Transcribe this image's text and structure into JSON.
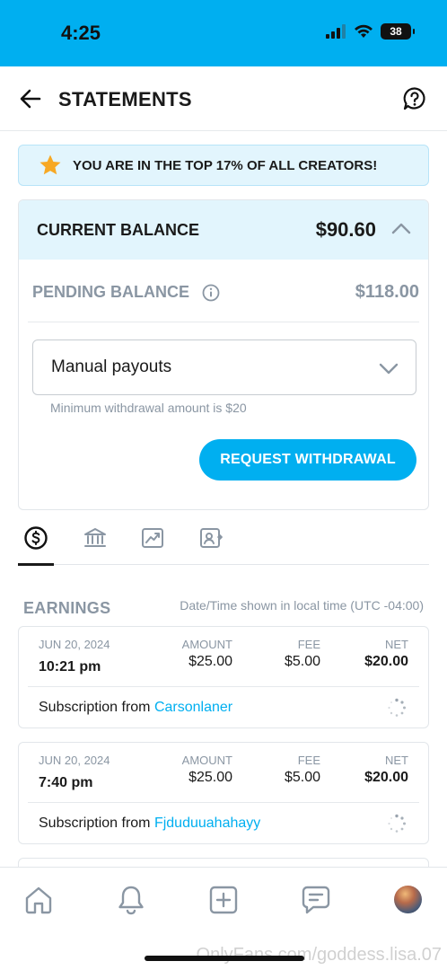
{
  "status_bar": {
    "time": "4:25",
    "battery": "38"
  },
  "header": {
    "title": "STATEMENTS"
  },
  "banner": {
    "text": "YOU ARE IN THE TOP 17% OF ALL CREATORS!"
  },
  "balance": {
    "current_label": "CURRENT BALANCE",
    "current_amount": "$90.60",
    "pending_label": "PENDING BALANCE",
    "pending_amount": "$118.00",
    "payout_mode": "Manual payouts",
    "min_note": "Minimum withdrawal amount is $20",
    "withdraw_label": "REQUEST WITHDRAWAL"
  },
  "tabs": [
    {
      "icon": "dollar-circle-icon"
    },
    {
      "icon": "bank-icon"
    },
    {
      "icon": "chart-icon"
    },
    {
      "icon": "id-card-icon"
    }
  ],
  "earnings": {
    "title": "EARNINGS",
    "note": "Date/Time shown in local time (UTC -04:00)",
    "col_amount": "AMOUNT",
    "col_fee": "FEE",
    "col_net": "NET",
    "rows": [
      {
        "date": "JUN 20, 2024",
        "time": "10:21 pm",
        "amount": "$25.00",
        "fee": "$5.00",
        "net": "$20.00",
        "desc": "Subscription from",
        "user": "Carsonlaner"
      },
      {
        "date": "JUN 20, 2024",
        "time": "7:40 pm",
        "amount": "$25.00",
        "fee": "$5.00",
        "net": "$20.00",
        "desc": "Subscription from",
        "user": "Fjduduuahahayy"
      }
    ]
  },
  "bottom_nav": {
    "items": [
      "home-icon",
      "bell-icon",
      "plus-square-icon",
      "message-icon",
      "avatar"
    ],
    "watermark": "OnlyFans.com/goddess.lisa.07"
  },
  "colors": {
    "brand": "#00aff0",
    "banner_bg": "#e2f5fd",
    "muted": "#8a96a3"
  }
}
